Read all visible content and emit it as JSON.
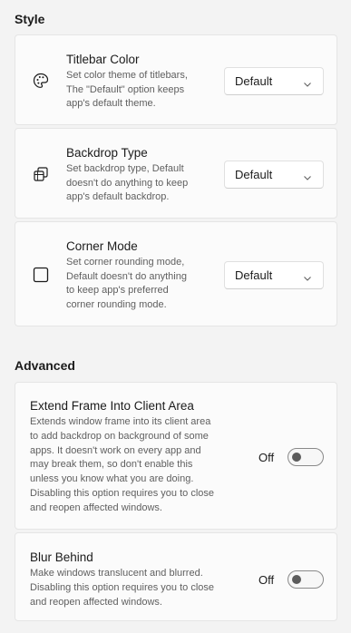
{
  "style_section": {
    "title": "Style",
    "items": [
      {
        "title": "Titlebar Color",
        "description": "Set color theme of titlebars,\nThe \"Default\" option keeps\napp's default theme.",
        "icon": "palette-icon",
        "value": "Default"
      },
      {
        "title": "Backdrop Type",
        "description": "Set backdrop type, Default\ndoesn't do anything to keep\napp's default backdrop.",
        "icon": "backdrop-icon",
        "value": "Default"
      },
      {
        "title": "Corner Mode",
        "description": "Set corner rounding mode,\nDefault doesn't do anything\nto keep app's preferred\ncorner rounding mode.",
        "icon": "square-icon",
        "value": "Default"
      }
    ]
  },
  "advanced_section": {
    "title": "Advanced",
    "items": [
      {
        "title": "Extend Frame Into Client Area",
        "description": "Extends window frame into its client area\nto add backdrop on background of some\napps. It doesn't work on every app and\nmay break them, so don't enable this\nunless you know what you are doing.\nDisabling this option requires you to close\nand reopen affected windows.",
        "toggle_label": "Off",
        "enabled": false
      },
      {
        "title": "Blur Behind",
        "description": "Make windows translucent and blurred.\nDisabling this option requires you to close\nand reopen affected windows.",
        "toggle_label": "Off",
        "enabled": false
      }
    ]
  },
  "colors": {
    "background": "#f3f3f3",
    "card": "#fbfbfb",
    "border": "#e5e5e5",
    "secondary_text": "#5f5f5f"
  }
}
